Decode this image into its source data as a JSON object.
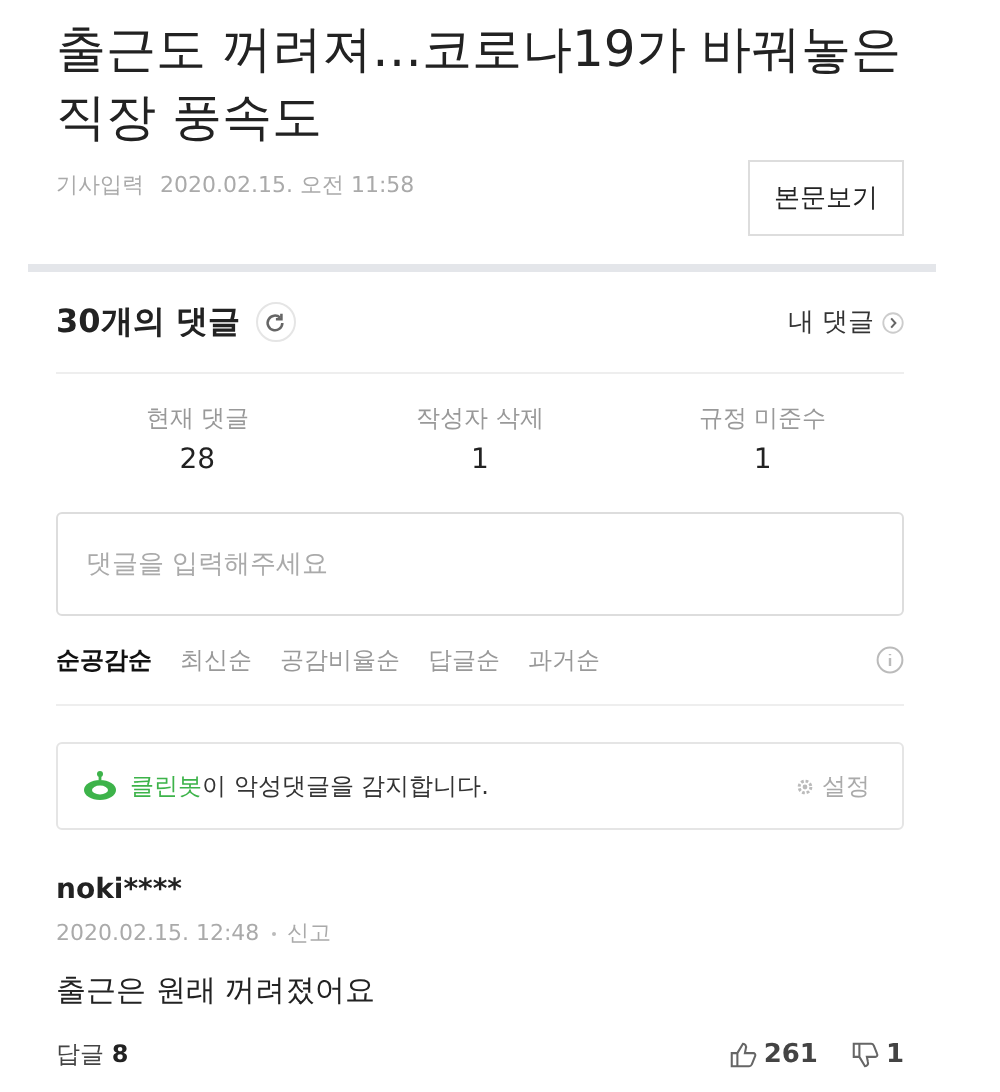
{
  "article": {
    "title": "출근도 꺼려져…코로나19가 바꿔놓은 직장 풍속도",
    "date_label": "기사입력",
    "date": "2020.02.15. 오전 11:58",
    "view_button": "본문보기"
  },
  "comments_header": {
    "count_title": "30개의 댓글",
    "my_comments": "내 댓글"
  },
  "stats": [
    {
      "label": "현재 댓글",
      "value": "28"
    },
    {
      "label": "작성자 삭제",
      "value": "1"
    },
    {
      "label": "규정 미준수",
      "value": "1"
    }
  ],
  "comment_input": {
    "placeholder": "댓글을 입력해주세요"
  },
  "sort_tabs": [
    {
      "label": "순공감순",
      "selected": true
    },
    {
      "label": "최신순",
      "selected": false
    },
    {
      "label": "공감비율순",
      "selected": false
    },
    {
      "label": "답글순",
      "selected": false
    },
    {
      "label": "과거순",
      "selected": false
    }
  ],
  "cleanbot": {
    "highlight": "클린봇",
    "text": "이 악성댓글을 감지합니다.",
    "settings": "설정"
  },
  "comments": [
    {
      "author": "noki****",
      "date": "2020.02.15. 12:48",
      "report": "신고",
      "body": "출근은 원래 꺼려졌어요",
      "replies": "답글 **8**",
      "likes": "261",
      "dislikes": "1"
    }
  ]
}
